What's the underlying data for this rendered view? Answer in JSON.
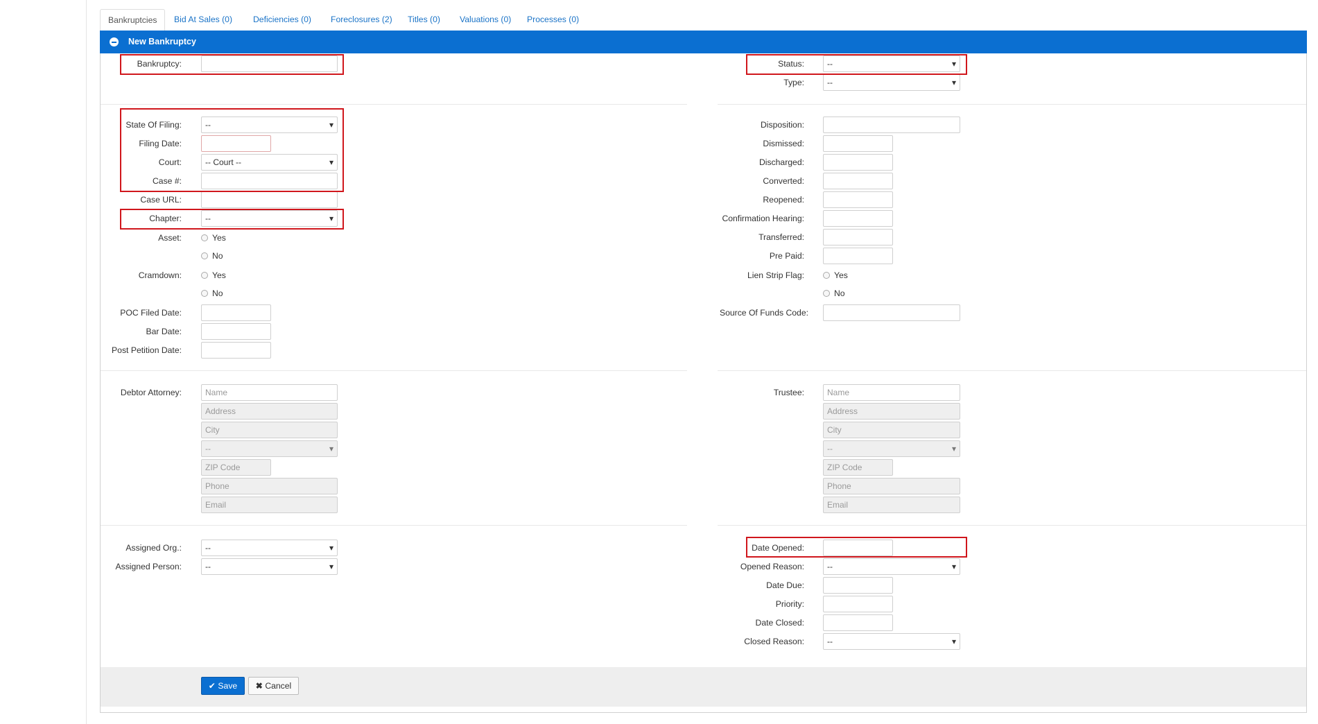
{
  "tabs": [
    {
      "label": "Bankruptcies"
    },
    {
      "label": "Bid At Sales (0)"
    },
    {
      "label": "Deficiencies (0)"
    },
    {
      "label": "Foreclosures (2)"
    },
    {
      "label": "Titles (0)"
    },
    {
      "label": "Valuations (0)"
    },
    {
      "label": "Processes (0)"
    }
  ],
  "panel": {
    "title": "New Bankruptcy"
  },
  "left": {
    "bankruptcy": {
      "label": "Bankruptcy:",
      "value": ""
    },
    "state_of_filing": {
      "label": "State Of Filing:",
      "value": "--"
    },
    "filing_date": {
      "label": "Filing Date:",
      "value": ""
    },
    "court": {
      "label": "Court:",
      "value": "-- Court --"
    },
    "case_no": {
      "label": "Case #:",
      "value": ""
    },
    "case_url": {
      "label": "Case URL:",
      "value": ""
    },
    "chapter": {
      "label": "Chapter:",
      "value": "--"
    },
    "asset": {
      "label": "Asset:",
      "yes": "Yes",
      "no": "No"
    },
    "cramdown": {
      "label": "Cramdown:",
      "yes": "Yes",
      "no": "No"
    },
    "poc_filed_date": {
      "label": "POC Filed Date:",
      "value": ""
    },
    "bar_date": {
      "label": "Bar Date:",
      "value": ""
    },
    "post_petition_date": {
      "label": "Post Petition Date:",
      "value": ""
    },
    "debtor_attorney": {
      "label": "Debtor Attorney:",
      "name_placeholder": "Name",
      "address_placeholder": "Address",
      "city_placeholder": "City",
      "state_value": "--",
      "zip_placeholder": "ZIP Code",
      "phone_placeholder": "Phone",
      "email_placeholder": "Email"
    },
    "assigned_org": {
      "label": "Assigned Org.:",
      "value": "--"
    },
    "assigned_person": {
      "label": "Assigned Person:",
      "value": "--"
    }
  },
  "right": {
    "status": {
      "label": "Status:",
      "value": "--"
    },
    "type": {
      "label": "Type:",
      "value": "--"
    },
    "disposition": {
      "label": "Disposition:",
      "value": ""
    },
    "dismissed": {
      "label": "Dismissed:",
      "value": ""
    },
    "discharged": {
      "label": "Discharged:",
      "value": ""
    },
    "converted": {
      "label": "Converted:",
      "value": ""
    },
    "reopened": {
      "label": "Reopened:",
      "value": ""
    },
    "confirmation_hearing": {
      "label": "Confirmation Hearing:",
      "value": ""
    },
    "transferred": {
      "label": "Transferred:",
      "value": ""
    },
    "pre_paid": {
      "label": "Pre Paid:",
      "value": ""
    },
    "lien_strip_flag": {
      "label": "Lien Strip Flag:",
      "yes": "Yes",
      "no": "No"
    },
    "source_of_funds_code": {
      "label": "Source Of Funds Code:",
      "value": ""
    },
    "trustee": {
      "label": "Trustee:",
      "name_placeholder": "Name",
      "address_placeholder": "Address",
      "city_placeholder": "City",
      "state_value": "--",
      "zip_placeholder": "ZIP Code",
      "phone_placeholder": "Phone",
      "email_placeholder": "Email"
    },
    "date_opened": {
      "label": "Date Opened:",
      "value": ""
    },
    "opened_reason": {
      "label": "Opened Reason:",
      "value": "--"
    },
    "date_due": {
      "label": "Date Due:",
      "value": ""
    },
    "priority": {
      "label": "Priority:",
      "value": ""
    },
    "date_closed": {
      "label": "Date Closed:",
      "value": ""
    },
    "closed_reason": {
      "label": "Closed Reason:",
      "value": "--"
    }
  },
  "actions": {
    "save_label": "Save",
    "cancel_label": "Cancel",
    "save_icon": "check-icon",
    "cancel_icon": "x-icon"
  },
  "colors": {
    "accent": "#0b6fd1",
    "highlight": "#d0161c"
  }
}
